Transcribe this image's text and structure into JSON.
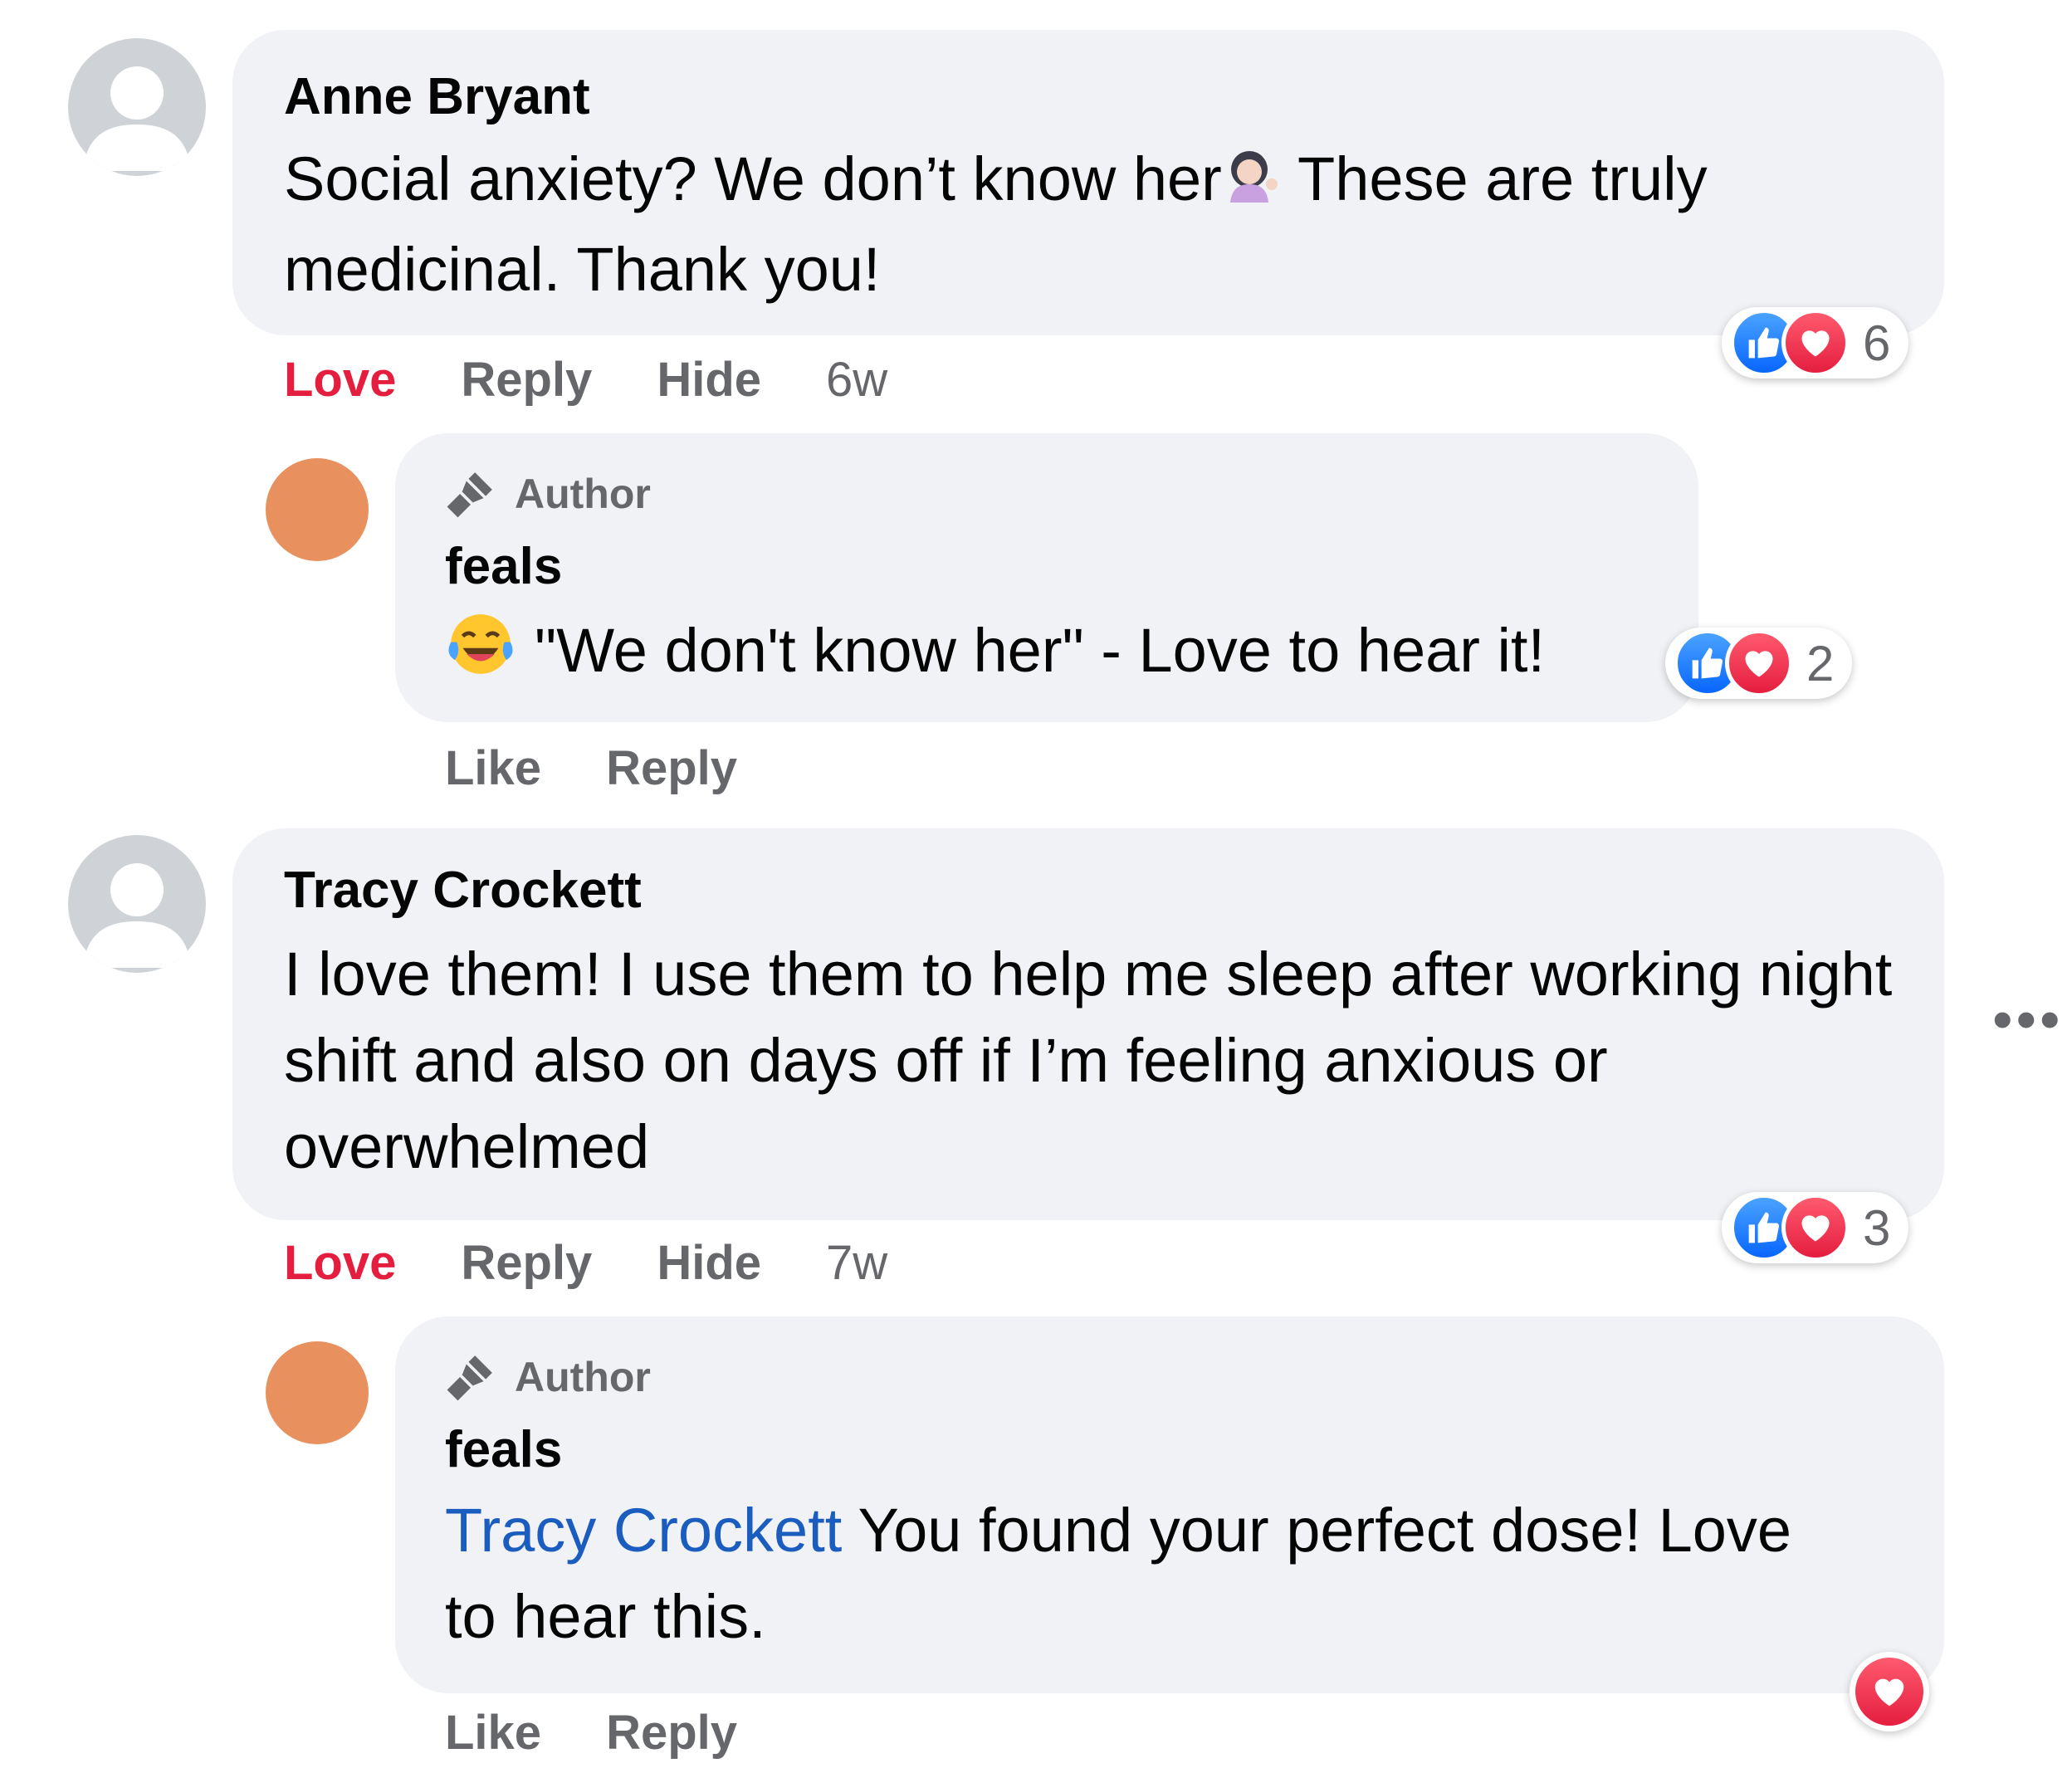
{
  "comments": [
    {
      "author": "Anne Bryant",
      "text_part1": "Social anxiety? We don’t know her",
      "text_part2": " These are truly medicinal. Thank you!",
      "emoji": "woman-tipping-hand-emoji",
      "actions": {
        "love": "Love",
        "reply": "Reply",
        "hide": "Hide",
        "time": "6w"
      },
      "reaction_count": "6",
      "reply": {
        "badge": "Author",
        "author": "feals",
        "emoji": "tears-of-joy-emoji",
        "text": "\"We don't know her\" - Love to hear it!",
        "actions": {
          "like": "Like",
          "reply": "Reply"
        },
        "reaction_count": "2"
      }
    },
    {
      "author": "Tracy Crockett",
      "text": "I love them! I use them to help me sleep after working night shift and also on days off if I’m feeling anxious or overwhelmed",
      "actions": {
        "love": "Love",
        "reply": "Reply",
        "hide": "Hide",
        "time": "7w"
      },
      "reaction_count": "3",
      "more_icon": "more-options-icon",
      "reply": {
        "badge": "Author",
        "author": "feals",
        "mention": "Tracy Crockett",
        "text": " You found your perfect dose! Love to hear this.",
        "actions": {
          "like": "Like",
          "reply": "Reply"
        }
      }
    }
  ],
  "colors": {
    "bubble": "#f0f2f5",
    "love": "#e41e3f",
    "like_blue": "#0866ff",
    "mention": "#1b5cbf",
    "meta": "#65676b",
    "page_avatar": "#e8915f"
  }
}
